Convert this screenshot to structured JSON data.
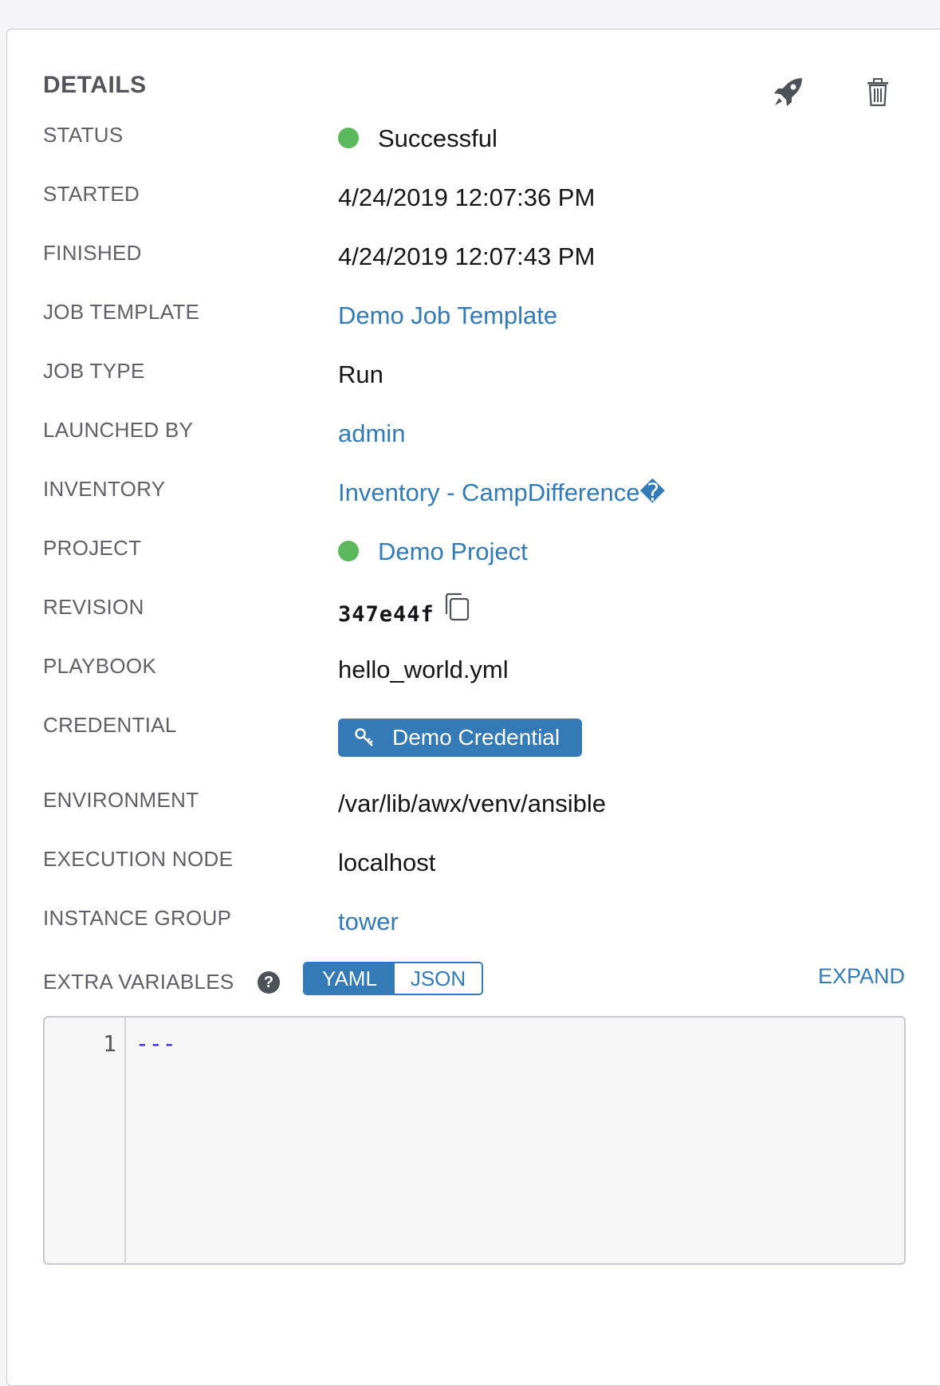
{
  "details": {
    "title": "DETAILS",
    "actions": {
      "relaunch_icon": "rocket-icon",
      "delete_icon": "trash-icon"
    },
    "fields": {
      "status": {
        "label": "STATUS",
        "value": "Successful",
        "indicator_color": "#5cb85c"
      },
      "started": {
        "label": "STARTED",
        "value": "4/24/2019 12:07:36 PM"
      },
      "finished": {
        "label": "FINISHED",
        "value": "4/24/2019 12:07:43 PM"
      },
      "job_template": {
        "label": "JOB TEMPLATE",
        "value": "Demo Job Template"
      },
      "job_type": {
        "label": "JOB TYPE",
        "value": "Run"
      },
      "launched_by": {
        "label": "LAUNCHED BY",
        "value": "admin"
      },
      "inventory": {
        "label": "INVENTORY",
        "value": "Inventory - CampDifference�"
      },
      "project": {
        "label": "PROJECT",
        "value": "Demo Project",
        "indicator_color": "#5cb85c"
      },
      "revision": {
        "label": "REVISION",
        "value": "347e44f",
        "copy_icon": "copy-icon"
      },
      "playbook": {
        "label": "PLAYBOOK",
        "value": "hello_world.yml"
      },
      "credential": {
        "label": "CREDENTIAL",
        "value": "Demo Credential",
        "icon": "key-icon"
      },
      "environment": {
        "label": "ENVIRONMENT",
        "value": "/var/lib/awx/venv/ansible"
      },
      "execution_node": {
        "label": "EXECUTION NODE",
        "value": "localhost"
      },
      "instance_group": {
        "label": "INSTANCE GROUP",
        "value": "tower"
      }
    },
    "extra_variables": {
      "label": "EXTRA VARIABLES",
      "help_icon": "question-circle-icon",
      "help_glyph": "?",
      "formats": [
        "YAML",
        "JSON"
      ],
      "selected_format": "YAML",
      "expand_label": "EXPAND",
      "editor": {
        "lines": [
          {
            "number": "1",
            "text": "---"
          }
        ]
      }
    }
  },
  "colors": {
    "accent": "#337ab7",
    "success": "#5cb85c",
    "label": "#606066",
    "text": "#161618"
  }
}
